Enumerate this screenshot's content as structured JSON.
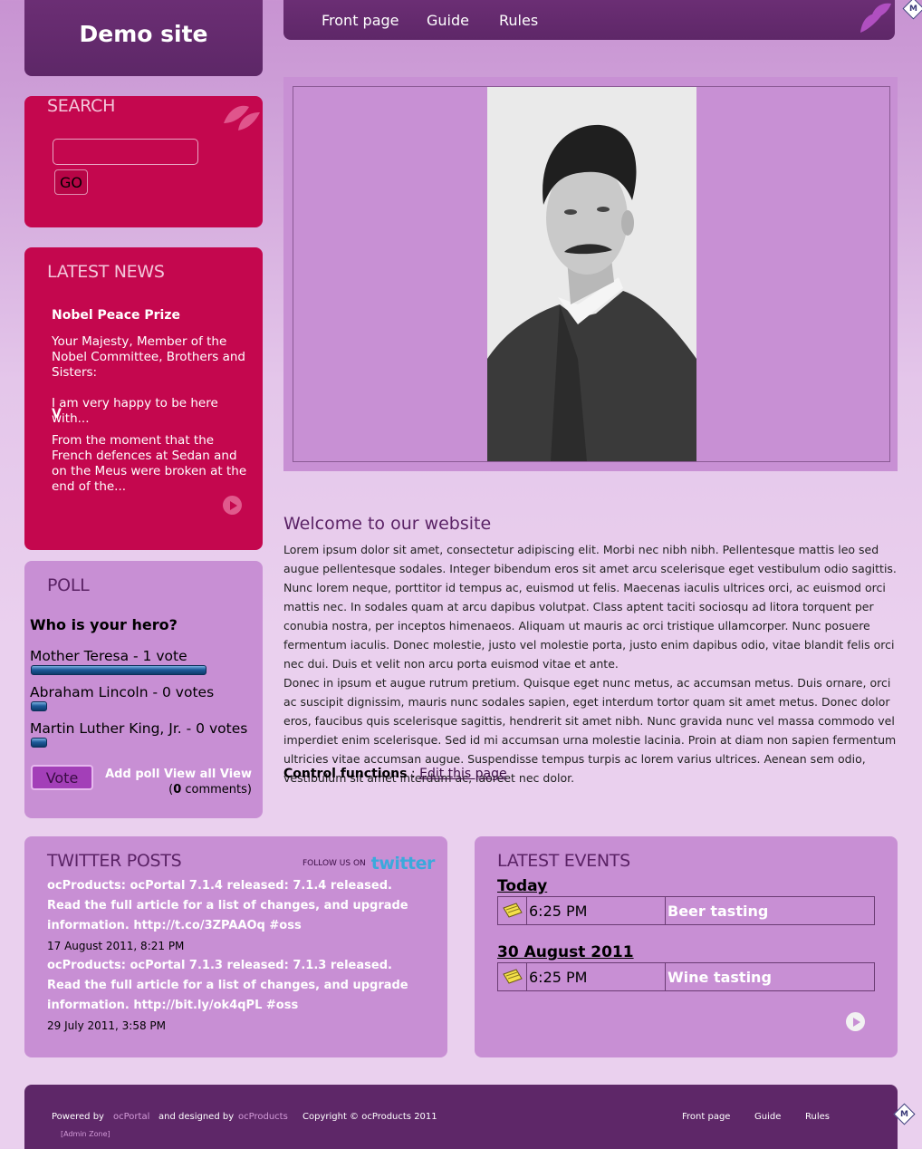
{
  "header": {
    "site_title": "Demo site",
    "nav": [
      "Front page",
      "Guide",
      "Rules"
    ]
  },
  "search": {
    "title": "SEARCH",
    "input_value": "",
    "go_label": "GO"
  },
  "news": {
    "title": "LATEST NEWS",
    "items": [
      {
        "title": "Nobel Peace Prize",
        "summary": "Your Majesty, Member of the Nobel Committee, Brothers and Sisters:\n\nI am very happy to be here with..."
      },
      {
        "title": "V",
        "summary": "From the moment that the French defences at Sedan and on the Meus were broken at the end of the..."
      }
    ]
  },
  "poll": {
    "title": "POLL",
    "question": "Who is your hero?",
    "options": [
      {
        "label": "Mother Teresa - 1 vote",
        "fraction": 1.0
      },
      {
        "label": "Abraham Lincoln - 0 votes",
        "fraction": 0.0
      },
      {
        "label": "Martin Luther King, Jr. - 0 votes",
        "fraction": 0.0
      }
    ],
    "vote_label": "Vote",
    "add_poll": "Add poll",
    "view_all": "View all",
    "view": "View",
    "comments_open": "(",
    "comments_count": "0",
    "comments_close": " comments)"
  },
  "main": {
    "welcome_title": "Welcome to our website",
    "paragraph1": "Lorem ipsum dolor sit amet, consectetur adipiscing elit. Morbi nec nibh nibh. Pellentesque mattis leo sed augue pellentesque sodales. Integer bibendum eros sit amet arcu scelerisque eget vestibulum odio sagittis. Nunc lorem neque, porttitor id tempus ac, euismod ut felis. Maecenas iaculis ultrices orci, ac euismod orci mattis nec. In sodales quam at arcu dapibus volutpat. Class aptent taciti sociosqu ad litora torquent per conubia nostra, per inceptos himenaeos. Aliquam ut mauris ac orci tristique ullamcorper. Nunc posuere fermentum iaculis. Donec molestie, justo vel molestie porta, justo enim dapibus odio, vitae blandit felis orci nec dui. Duis et velit non arcu porta euismod vitae et ante.",
    "paragraph2": "Donec in ipsum et augue rutrum pretium. Quisque eget nunc metus, ac accumsan metus. Duis ornare, orci ac suscipit dignissim, mauris nunc sodales sapien, eget interdum tortor quam sit amet metus. Donec dolor eros, faucibus quis scelerisque sagittis, hendrerit sit amet nibh. Nunc gravida nunc vel massa commodo vel imperdiet enim scelerisque. Sed id mi accumsan urna molestie lacinia. Proin at diam non sapien fermentum ultricies vitae accumsan augue. Suspendisse tempus turpis ac lorem varius ultrices. Aenean sem odio, vestibulum sit amet interdum ac, laoreet nec dolor.",
    "control_label": "Control functions",
    "control_sep": " : ",
    "edit_link": "Edit this page"
  },
  "twitter": {
    "title": "TWITTER POSTS",
    "follow_label": "FOLLOW US ON",
    "follow_brand": "twitter",
    "posts": [
      {
        "text": "ocProducts: ocPortal 7.1.4 released: 7.1.4 released. Read the full article for a list of changes, and upgrade information. http://t.co/3ZPAAOq #oss",
        "date": "17 August 2011, 8:21 PM"
      },
      {
        "text": "ocProducts: ocPortal 7.1.3 released: 7.1.3 released. Read the full article for a list of changes, and upgrade information. http://bit.ly/ok4qPL #oss",
        "date": "29 July 2011, 3:58 PM"
      }
    ]
  },
  "events": {
    "title": "LATEST EVENTS",
    "groups": [
      {
        "date": "Today",
        "time": "6:25 PM",
        "name": "Beer tasting"
      },
      {
        "date": "30 August 2011",
        "time": "6:25 PM",
        "name": "Wine tasting"
      }
    ]
  },
  "footer": {
    "powered_by": "Powered by",
    "ocportal": "ocPortal",
    "designed_by": "and designed by",
    "ocproducts": "ocProducts",
    "copyright": "Copyright © ocProducts 2011",
    "admin_zone": "[Admin Zone]",
    "nav": [
      "Front page",
      "Guide",
      "Rules"
    ]
  },
  "colors": {
    "header_purple": "#5e2768",
    "panel_crimson": "#c4074e",
    "panel_lilac": "#c88fd4",
    "title_purple": "#5b2366"
  }
}
